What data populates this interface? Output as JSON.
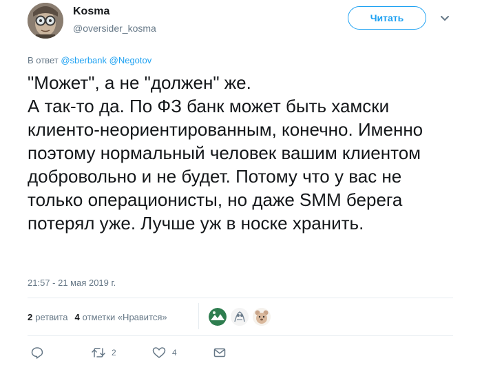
{
  "author": {
    "name": "Kosma",
    "handle": "@oversider_kosma"
  },
  "follow_label": "Читать",
  "reply_to": {
    "prefix": "В ответ",
    "mentions": [
      "@sberbank",
      "@Negotov"
    ]
  },
  "tweet_text": "\"Может\", а не \"должен\" же.\nА так-то да. По ФЗ банк может быть хамски клиенто-неориентированным, конечно. Именно поэтому нормальный человек вашим клиентом добровольно и не будет. Потому что у вас не только операционисты, но даже SMM берега потерял уже. Лучше уж в носке хранить.",
  "timestamp": "21:57 - 21 мая 2019 г.",
  "stats": {
    "retweets_count": "2",
    "retweets_label": "ретвита",
    "likes_count": "4",
    "likes_label": "отметки «Нравится»"
  },
  "actions": {
    "reply": {
      "icon": "reply-icon"
    },
    "retweet": {
      "icon": "retweet-icon",
      "count": "2"
    },
    "like": {
      "icon": "heart-icon",
      "count": "4"
    },
    "message": {
      "icon": "envelope-icon"
    }
  },
  "colors": {
    "accent": "#1da1f2",
    "secondary_text": "#657786",
    "divider": "#e6ecf0"
  }
}
